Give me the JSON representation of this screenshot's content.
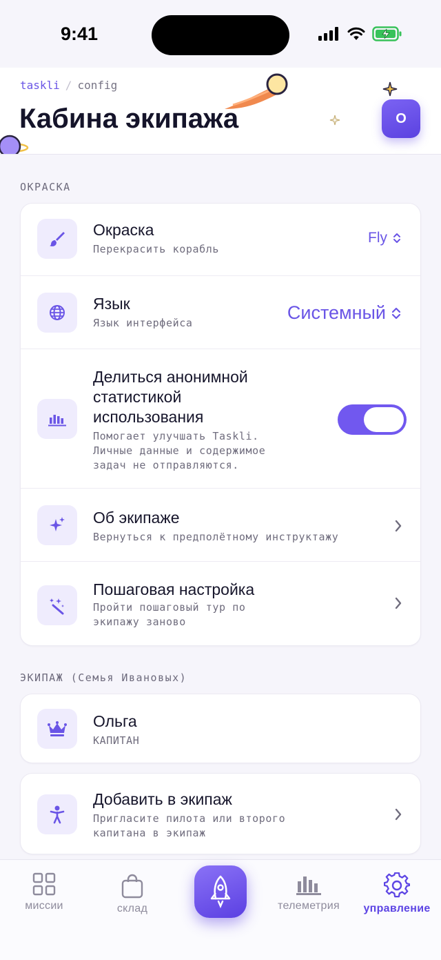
{
  "status_bar": {
    "time": "9:41"
  },
  "header": {
    "breadcrumb": {
      "brand": "taskli",
      "separator": "/",
      "current": "config"
    },
    "title": "Кабина экипажа",
    "avatar_initial": "O"
  },
  "sections": {
    "paint": {
      "label": "ОКРАСКА",
      "rows": [
        {
          "title": "Окраска",
          "subtitle": "Перекрасить корабль",
          "value": "Fly",
          "icon": "paintbrush-icon"
        },
        {
          "title": "Язык",
          "subtitle": "Язык интерфейса",
          "value": "Системный",
          "icon": "globe-icon"
        },
        {
          "title_lines": [
            "Делиться анонимной",
            "статистикой",
            "использования"
          ],
          "subtitle_lines": [
            "Помогает улучшать Taskli.",
            "Личные данные и содержимое",
            "задач не отправляются."
          ],
          "toggle_on": true,
          "icon": "bar-chart-icon"
        },
        {
          "title": "Об экипаже",
          "subtitle": "Вернуться к предполётному инструктажу",
          "icon": "sparkles-icon"
        },
        {
          "title": "Пошаговая настройка",
          "subtitle_lines": [
            "Пройти пошаговый тур по",
            "экипажу заново"
          ],
          "icon": "magic-wand-icon"
        }
      ]
    },
    "crew": {
      "label": "ЭКИПАЖ (Семья Ивановых)",
      "member": {
        "name": "Ольга",
        "role": "КАПИТАН",
        "icon": "crown-icon"
      },
      "add": {
        "title": "Добавить в экипаж",
        "subtitle_lines": [
          "Пригласите пилота или второго",
          "капитана в экипаж"
        ],
        "icon": "person-icon"
      }
    }
  },
  "tabbar": {
    "tabs": [
      {
        "label": "миссии",
        "icon": "grid-icon"
      },
      {
        "label": "склад",
        "icon": "bag-icon"
      },
      {
        "label": "",
        "icon": "rocket-icon"
      },
      {
        "label": "телеметрия",
        "icon": "bar-chart-icon"
      },
      {
        "label": "управление",
        "icon": "gear-icon",
        "active": true
      }
    ]
  },
  "colors": {
    "accent": "#6a55e6",
    "background": "#f6f5fb",
    "card": "#ffffff",
    "tile": "#efecfd"
  }
}
